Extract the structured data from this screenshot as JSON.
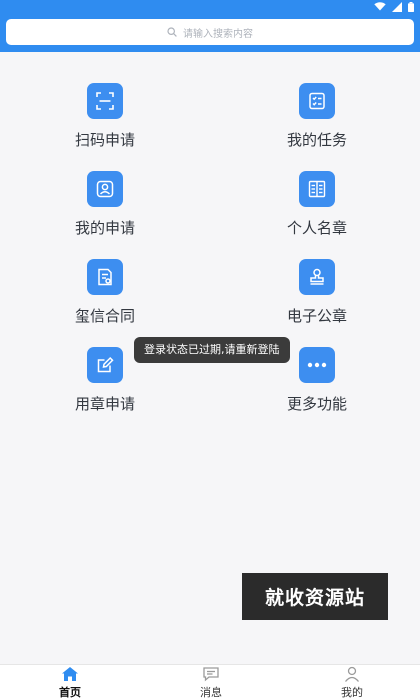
{
  "search": {
    "placeholder": "请输入搜索内容"
  },
  "grid": [
    {
      "label": "扫码申请",
      "icon": "scan-icon"
    },
    {
      "label": "我的任务",
      "icon": "task-list-icon"
    },
    {
      "label": "我的申请",
      "icon": "user-icon"
    },
    {
      "label": "个人名章",
      "icon": "name-seal-icon"
    },
    {
      "label": "玺信合同",
      "icon": "contract-icon"
    },
    {
      "label": "电子公章",
      "icon": "official-seal-icon"
    },
    {
      "label": "用章申请",
      "icon": "edit-icon"
    },
    {
      "label": "更多功能",
      "icon": "more-icon"
    }
  ],
  "toast": {
    "text": "登录状态已过期,请重新登陆"
  },
  "watermark": {
    "text": "就收资源站"
  },
  "tabbar": {
    "items": [
      {
        "label": "首页",
        "icon": "home-icon",
        "active": true
      },
      {
        "label": "消息",
        "icon": "message-icon",
        "active": false
      },
      {
        "label": "我的",
        "icon": "profile-icon",
        "active": false
      }
    ]
  },
  "colors": {
    "brand": "#2f8cf0",
    "tile": "#3d8ef0",
    "toast_bg": "#3b3b3b",
    "text": "#333840"
  }
}
